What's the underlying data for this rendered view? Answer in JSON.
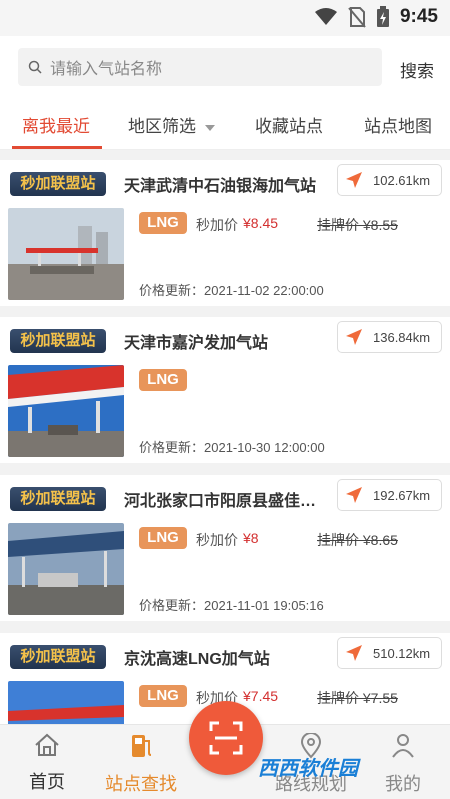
{
  "status_bar": {
    "time": "9:45"
  },
  "search": {
    "placeholder": "请输入气站名称",
    "button": "搜索"
  },
  "tabs": [
    {
      "label": "离我最近"
    },
    {
      "label": "地区筛选"
    },
    {
      "label": "收藏站点"
    },
    {
      "label": "站点地图"
    }
  ],
  "stations": [
    {
      "badge": "秒加联盟站",
      "name": "天津武清中石油银海加气站",
      "distance": "102.61km",
      "fuel": "LNG",
      "sec_label": "秒加价",
      "sec_price": "¥8.45",
      "list_price": "挂牌价 ¥8.55",
      "update": "价格更新：2021-11-02 22:00:00"
    },
    {
      "badge": "秒加联盟站",
      "name": "天津市嘉沪发加气站",
      "distance": "136.84km",
      "fuel": "LNG",
      "sec_label": "",
      "sec_price": "",
      "list_price": "",
      "update": "价格更新：2021-10-30 12:00:00"
    },
    {
      "badge": "秒加联盟站",
      "name": "河北张家口市阳原县盛佳源...",
      "distance": "192.67km",
      "fuel": "LNG",
      "sec_label": "秒加价",
      "sec_price": "¥8",
      "list_price": "挂牌价 ¥8.65",
      "update": "价格更新：2021-11-01 19:05:16"
    },
    {
      "badge": "秒加联盟站",
      "name": "京沈高速LNG加气站",
      "distance": "510.12km",
      "fuel": "LNG",
      "sec_label": "秒加价",
      "sec_price": "¥7.45",
      "list_price": "挂牌价 ¥7.55",
      "update": ""
    }
  ],
  "bottom_nav": [
    {
      "label": "首页"
    },
    {
      "label": "站点查找"
    },
    {
      "label": "路线规划"
    },
    {
      "label": "我的"
    }
  ],
  "watermark": "西西软件园",
  "colors": {
    "accent": "#e24a33",
    "nav_active": "#e58a2d",
    "price": "#d32f2f",
    "lng_tag": "#e8955a",
    "badge_bg": "#22344f",
    "badge_text": "#f5c24a"
  }
}
